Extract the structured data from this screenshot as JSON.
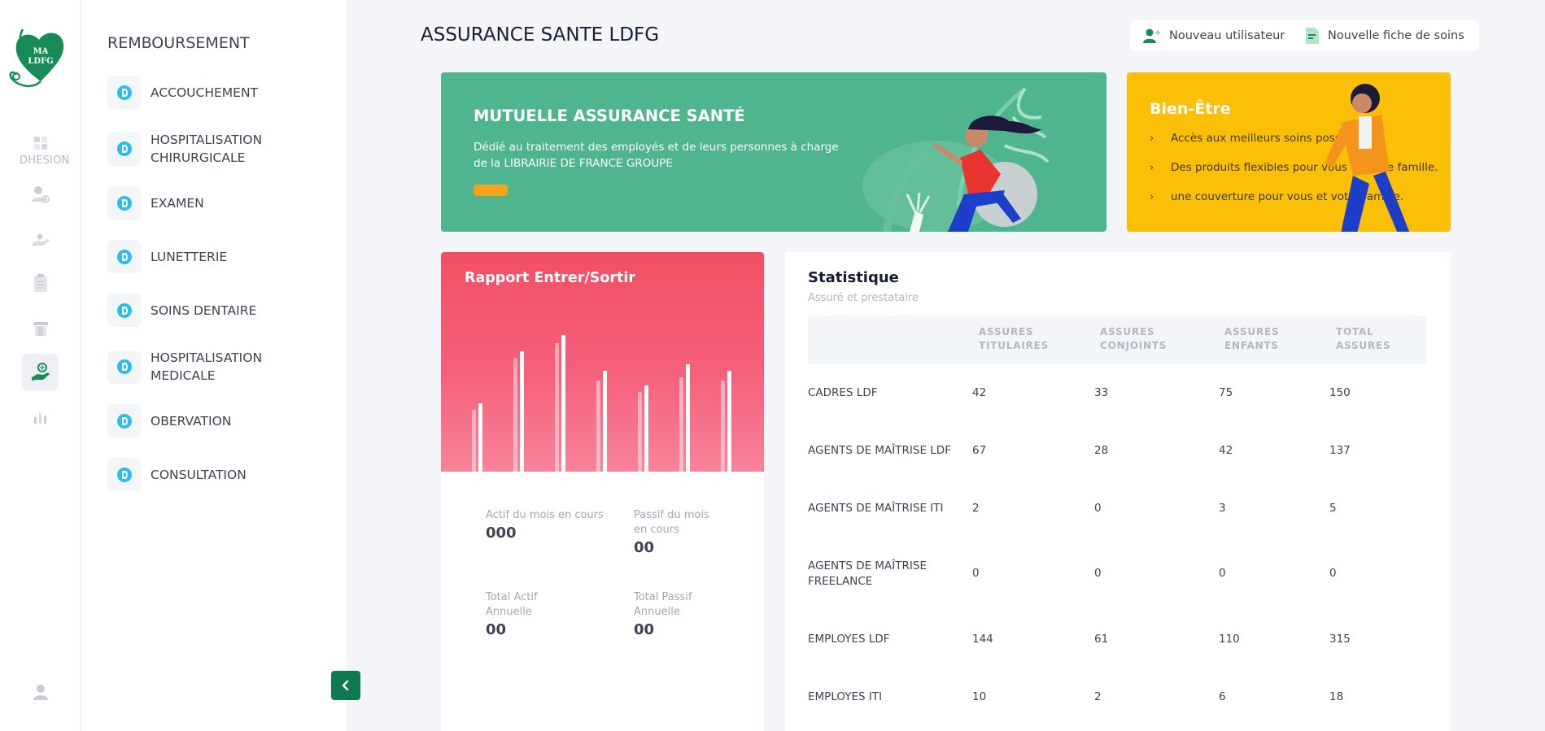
{
  "rail": {
    "logo_text_1": "MA",
    "logo_text_2": "LDFG",
    "cut_label": "DHESION",
    "items": [
      {
        "icon": "dashboard-icon"
      },
      {
        "icon": "user-add-icon"
      },
      {
        "icon": "hand-coin-icon"
      },
      {
        "icon": "clipboard-icon"
      },
      {
        "icon": "archive-icon"
      },
      {
        "icon": "care-hand-icon",
        "active": true
      },
      {
        "icon": "bar-chart-icon"
      }
    ],
    "bottom_icon": "user-icon"
  },
  "aside": {
    "title": "REMBOURSEMENT",
    "items": [
      {
        "label": "ACCOUCHEMENT"
      },
      {
        "label": "HOSPITALISATION CHIRURGICALE"
      },
      {
        "label": "EXAMEN"
      },
      {
        "label": "LUNETTERIE"
      },
      {
        "label": "SOINS DENTAIRE"
      },
      {
        "label": "HOSPITALISATION MEDICALE"
      },
      {
        "label": "OBERVATION"
      },
      {
        "label": "CONSULTATION"
      }
    ]
  },
  "header": {
    "title": "ASSURANCE SANTE LDFG",
    "btn_new_user": "Nouveau utilisateur",
    "btn_new_sheet": "Nouvelle fiche de soins"
  },
  "banner_green": {
    "title": "MUTUELLE ASSURANCE SANTÉ",
    "text": "Dédié au traitement des employés et de leurs personnes à charge de la LIBRAIRIE DE FRANCE GROUPE"
  },
  "banner_yellow": {
    "title": "Bien-Être",
    "items": [
      "Accès aux meilleurs soins possibles.",
      "Des produits flexibles pour vous et votre famille.",
      "une couverture pour vous et votre famille."
    ]
  },
  "report": {
    "title": "Rapport Entrer/Sortir",
    "bars": [
      [
        38,
        42
      ],
      [
        70,
        74
      ],
      [
        79,
        84
      ],
      [
        56,
        62
      ],
      [
        49,
        53
      ],
      [
        58,
        66
      ],
      [
        56,
        62
      ]
    ],
    "stats": [
      {
        "label": "Actif du mois en cours",
        "value": "000"
      },
      {
        "label": "Passif du mois en cours",
        "value": "00"
      },
      {
        "label": "Total Actif Annuelle",
        "value": "00"
      },
      {
        "label": "Total Passif Annuelle",
        "value": "00"
      }
    ]
  },
  "statistique": {
    "title": "Statistique",
    "subtitle": "Assuré et prestataire",
    "headers": [
      "",
      "ASSURES TITULAIRES",
      "ASSURES CONJOINTS",
      "ASSURES ENFANTS",
      "TOTAL ASSURES"
    ],
    "rows": [
      [
        "CADRES LDF",
        "42",
        "33",
        "75",
        "150"
      ],
      [
        "AGENTS DE MAÎTRISE LDF",
        "67",
        "28",
        "42",
        "137"
      ],
      [
        "AGENTS DE MAÎTRISE ITI",
        "2",
        "0",
        "3",
        "5"
      ],
      [
        "AGENTS DE MAÎTRISE FREELANCE",
        "0",
        "0",
        "0",
        "0"
      ],
      [
        "EMPLOYES LDF",
        "144",
        "61",
        "110",
        "315"
      ],
      [
        "EMPLOYES ITI",
        "10",
        "2",
        "6",
        "18"
      ]
    ]
  },
  "colors": {
    "brand_green": "#0e7a4f",
    "banner_green": "#4fb58e",
    "banner_yellow": "#fbbf07",
    "report_red": "#f24f64"
  }
}
